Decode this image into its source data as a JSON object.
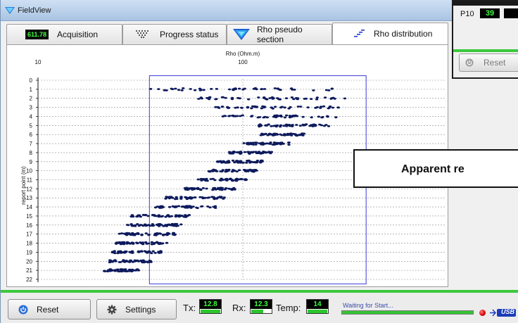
{
  "window": {
    "title": "FieldView"
  },
  "tabs": [
    {
      "label": "Acquisition",
      "badge": "611.78",
      "icon": "acquisition-display-icon"
    },
    {
      "label": "Progress status",
      "icon": "progress-grid-icon"
    },
    {
      "label": "Rho pseudo section",
      "icon": "pseudo-section-icon"
    },
    {
      "label": "Rho distribution",
      "icon": "distribution-icon",
      "active": true
    }
  ],
  "chart_data": {
    "type": "scatter",
    "title": "Rho (Ohm.m)",
    "xlabel": "Rho (Ohm.m)",
    "ylabel": "report point (m)",
    "xscale": "log",
    "xlim": [
      10,
      1000
    ],
    "xticks": [
      "10",
      "100"
    ],
    "ylim": [
      0,
      22
    ],
    "yticks": [
      "0",
      "1",
      "2",
      "3",
      "4",
      "5",
      "6",
      "7",
      "8",
      "9",
      "10",
      "11",
      "12",
      "13",
      "14",
      "15",
      "16",
      "17",
      "18",
      "19",
      "20",
      "21",
      "22"
    ],
    "grid": true,
    "marker_color": "#0d1a5c",
    "highlight_box": {
      "x_range_rho": [
        35,
        400
      ],
      "y_range": [
        -0.5,
        22.5
      ],
      "color": "#3b3bd6"
    },
    "rows": [
      {
        "y": 1,
        "rho_min": 35,
        "rho_max": 300
      },
      {
        "y": 2,
        "rho_min": 60,
        "rho_max": 330
      },
      {
        "y": 3,
        "rho_min": 70,
        "rho_max": 310
      },
      {
        "y": 4,
        "rho_min": 80,
        "rho_max": 300
      },
      {
        "y": 5,
        "rho_min": 120,
        "rho_max": 270
      },
      {
        "y": 6,
        "rho_min": 120,
        "rho_max": 200
      },
      {
        "y": 7,
        "rho_min": 100,
        "rho_max": 170
      },
      {
        "y": 8,
        "rho_min": 85,
        "rho_max": 140
      },
      {
        "y": 9,
        "rho_min": 75,
        "rho_max": 125
      },
      {
        "y": 10,
        "rho_min": 68,
        "rho_max": 118
      },
      {
        "y": 11,
        "rho_min": 60,
        "rho_max": 105
      },
      {
        "y": 12,
        "rho_min": 52,
        "rho_max": 92
      },
      {
        "y": 13,
        "rho_min": 42,
        "rho_max": 82
      },
      {
        "y": 14,
        "rho_min": 36,
        "rho_max": 74
      },
      {
        "y": 15,
        "rho_min": 28,
        "rho_max": 55
      },
      {
        "y": 16,
        "rho_min": 27,
        "rho_max": 50
      },
      {
        "y": 17,
        "rho_min": 25,
        "rho_max": 48
      },
      {
        "y": 18,
        "rho_min": 24,
        "rho_max": 44
      },
      {
        "y": 19,
        "rho_min": 23,
        "rho_max": 40
      },
      {
        "y": 20,
        "rho_min": 22,
        "rho_max": 36
      },
      {
        "y": 21,
        "rho_min": 21,
        "rho_max": 31
      }
    ]
  },
  "callout": {
    "text": "Apparent re"
  },
  "overlay": {
    "p10_label": "P10",
    "p10_value": "39",
    "reset_label": "Reset"
  },
  "statusbar": {
    "reset_label": "Reset",
    "settings_label": "Settings",
    "tx_label": "Tx:",
    "tx_value": "12.8",
    "tx_fill": 1.0,
    "rx_label": "Rx:",
    "rx_value": "12.3",
    "rx_fill": 0.6,
    "temp_label": "Temp:",
    "temp_value": "14",
    "temp_fill": 1.0,
    "status_text": "Waiting for Start...",
    "progress": 1.0,
    "usb_label": "USB",
    "led_color": "#d40000"
  }
}
